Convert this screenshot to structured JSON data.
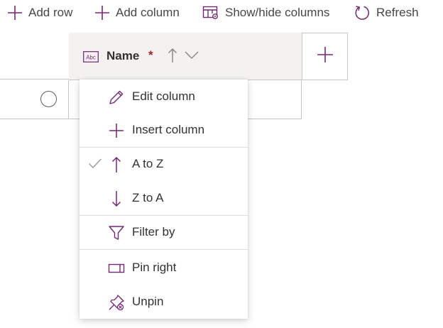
{
  "toolbar": {
    "add_row": "Add row",
    "add_column": "Add column",
    "show_hide": "Show/hide columns",
    "refresh": "Refresh"
  },
  "grid": {
    "column_name": "Name",
    "required_marker": "*",
    "type_icon": "Abc"
  },
  "menu": {
    "edit_column": "Edit column",
    "insert_column": "Insert column",
    "a_to_z": "A to Z",
    "z_to_a": "Z to A",
    "filter_by": "Filter by",
    "pin_right": "Pin right",
    "unpin": "Unpin"
  },
  "colors": {
    "accent": "#742774",
    "header_bg": "#f3f2f1",
    "border": "#c8c6c4"
  }
}
